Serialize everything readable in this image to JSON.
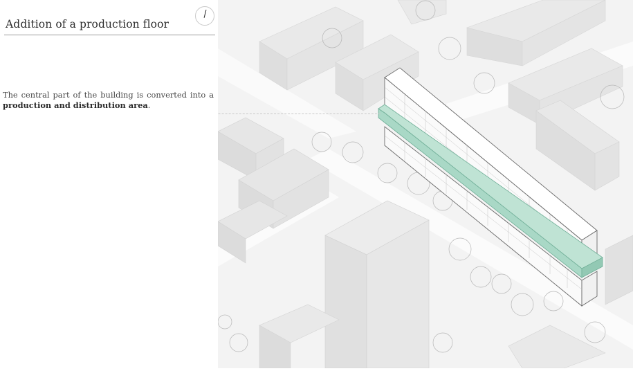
{
  "header": {
    "title": "Addition of a production floor"
  },
  "icons": {
    "north_arrow": "north-arrow-icon"
  },
  "description": {
    "text_before": "The central part of the building is converted into a ",
    "text_bold": "production and distribution area",
    "text_after": "."
  },
  "colors": {
    "background": "#ffffff",
    "city": "#ececec",
    "city_dark": "#dcdcdc",
    "building_outline": "#6b6b6b",
    "production_floor": "#a9d8c6",
    "production_floor_edge": "#6fae97"
  }
}
